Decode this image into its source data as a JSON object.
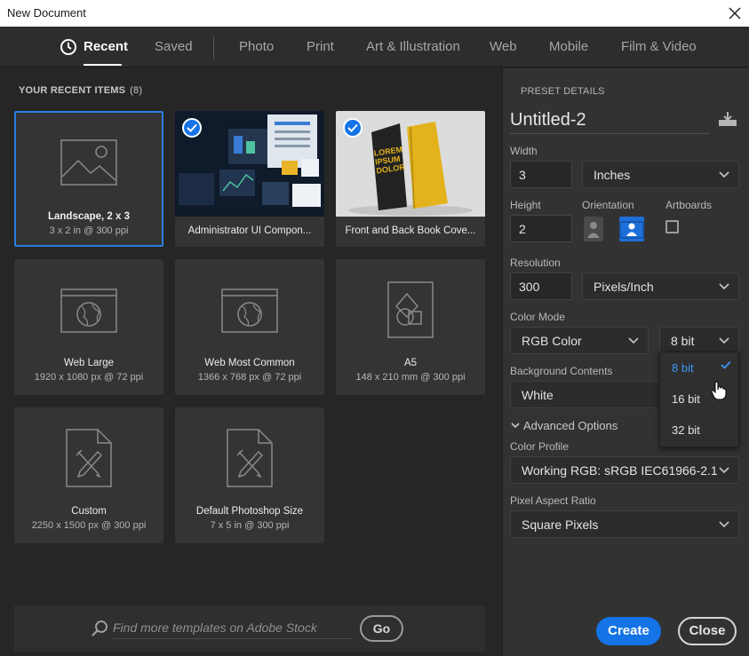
{
  "window": {
    "title": "New Document",
    "close_icon": "close-icon"
  },
  "nav": {
    "tabs": [
      {
        "label": "Recent",
        "active": true
      },
      {
        "label": "Saved"
      },
      {
        "label": "Photo"
      },
      {
        "label": "Print"
      },
      {
        "label": "Art & Illustration"
      },
      {
        "label": "Web"
      },
      {
        "label": "Mobile"
      },
      {
        "label": "Film & Video"
      }
    ]
  },
  "recent": {
    "heading": "YOUR RECENT ITEMS",
    "count": "(8)",
    "items": [
      {
        "label": "Landscape, 2 x 3",
        "sub": "3 x 2 in @ 300 ppi",
        "icon": "image-icon",
        "selected": true
      },
      {
        "label": "Administrator UI Compon...",
        "icon": "dashboard-thumbnail",
        "checked": true
      },
      {
        "label": "Front and Back Book Cove...",
        "icon": "book-thumbnail",
        "checked": true
      },
      {
        "label": "Web Large",
        "sub": "1920 x 1080 px @ 72 ppi",
        "icon": "web-icon"
      },
      {
        "label": "Web Most Common",
        "sub": "1366 x 768 px @ 72 ppi",
        "icon": "web-icon"
      },
      {
        "label": "A5",
        "sub": "148 x 210 mm @ 300 ppi",
        "icon": "print-icon"
      },
      {
        "label": "Custom",
        "sub": "2250 x 1500 px @ 300 ppi",
        "icon": "art-icon"
      },
      {
        "label": "Default Photoshop Size",
        "sub": "7 x 5 in @ 300 ppi",
        "icon": "art-icon"
      }
    ],
    "book_cover_text": "LOREM IPSUM DOLOR"
  },
  "search": {
    "placeholder": "Find more templates on Adobe Stock",
    "go_label": "Go"
  },
  "preset": {
    "heading": "PRESET DETAILS",
    "name": "Untitled-2",
    "width_label": "Width",
    "width_value": "3",
    "width_unit": "Inches",
    "height_label": "Height",
    "height_value": "2",
    "orientation_label": "Orientation",
    "artboards_label": "Artboards",
    "resolution_label": "Resolution",
    "resolution_value": "300",
    "resolution_unit": "Pixels/Inch",
    "color_mode_label": "Color Mode",
    "color_mode_value": "RGB Color",
    "bit_depth_value": "8 bit",
    "bit_depth_options": [
      "8 bit",
      "16 bit",
      "32 bit"
    ],
    "background_label": "Background Contents",
    "background_value": "White",
    "advanced_label": "Advanced Options",
    "color_profile_label": "Color Profile",
    "color_profile_value": "Working RGB: sRGB IEC61966-2.1",
    "pixel_aspect_label": "Pixel Aspect Ratio",
    "pixel_aspect_value": "Square Pixels"
  },
  "actions": {
    "create_label": "Create",
    "close_label": "Close"
  },
  "colors": {
    "accent": "#1473e6",
    "selected_option": "#3c95f5",
    "book_yellow": "#e3b21c"
  }
}
